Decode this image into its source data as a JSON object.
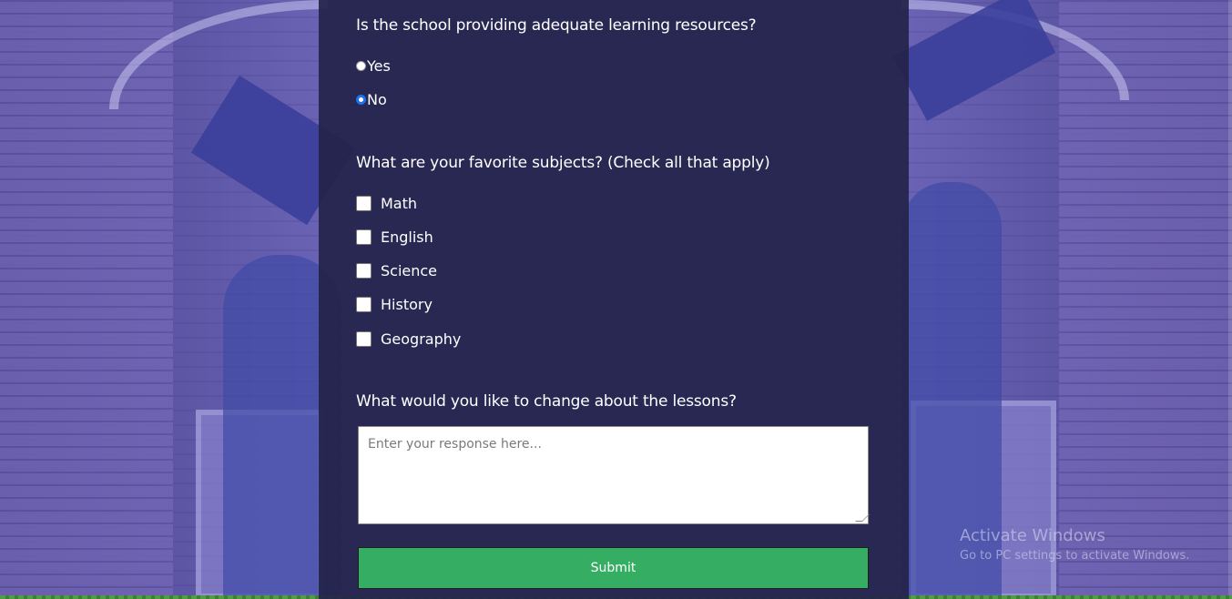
{
  "form": {
    "q1": {
      "title": "Is the school providing adequate learning resources?",
      "options": [
        {
          "label": "Yes",
          "checked": false
        },
        {
          "label": "No",
          "checked": true
        }
      ]
    },
    "q2": {
      "title": "What are your favorite subjects? (Check all that apply)",
      "options": [
        {
          "label": "Math"
        },
        {
          "label": "English"
        },
        {
          "label": "Science"
        },
        {
          "label": "History"
        },
        {
          "label": "Geography"
        }
      ]
    },
    "q3": {
      "title": "What would you like to change about the lessons?",
      "placeholder": "Enter your response here..."
    },
    "submit_label": "Submit"
  },
  "watermark": {
    "title": "Activate Windows",
    "subtitle": "Go to PC settings to activate Windows."
  },
  "colors": {
    "card_bg": "#24244a",
    "submit_bg": "#35ad62",
    "radio_checked": "#1a73e8"
  }
}
